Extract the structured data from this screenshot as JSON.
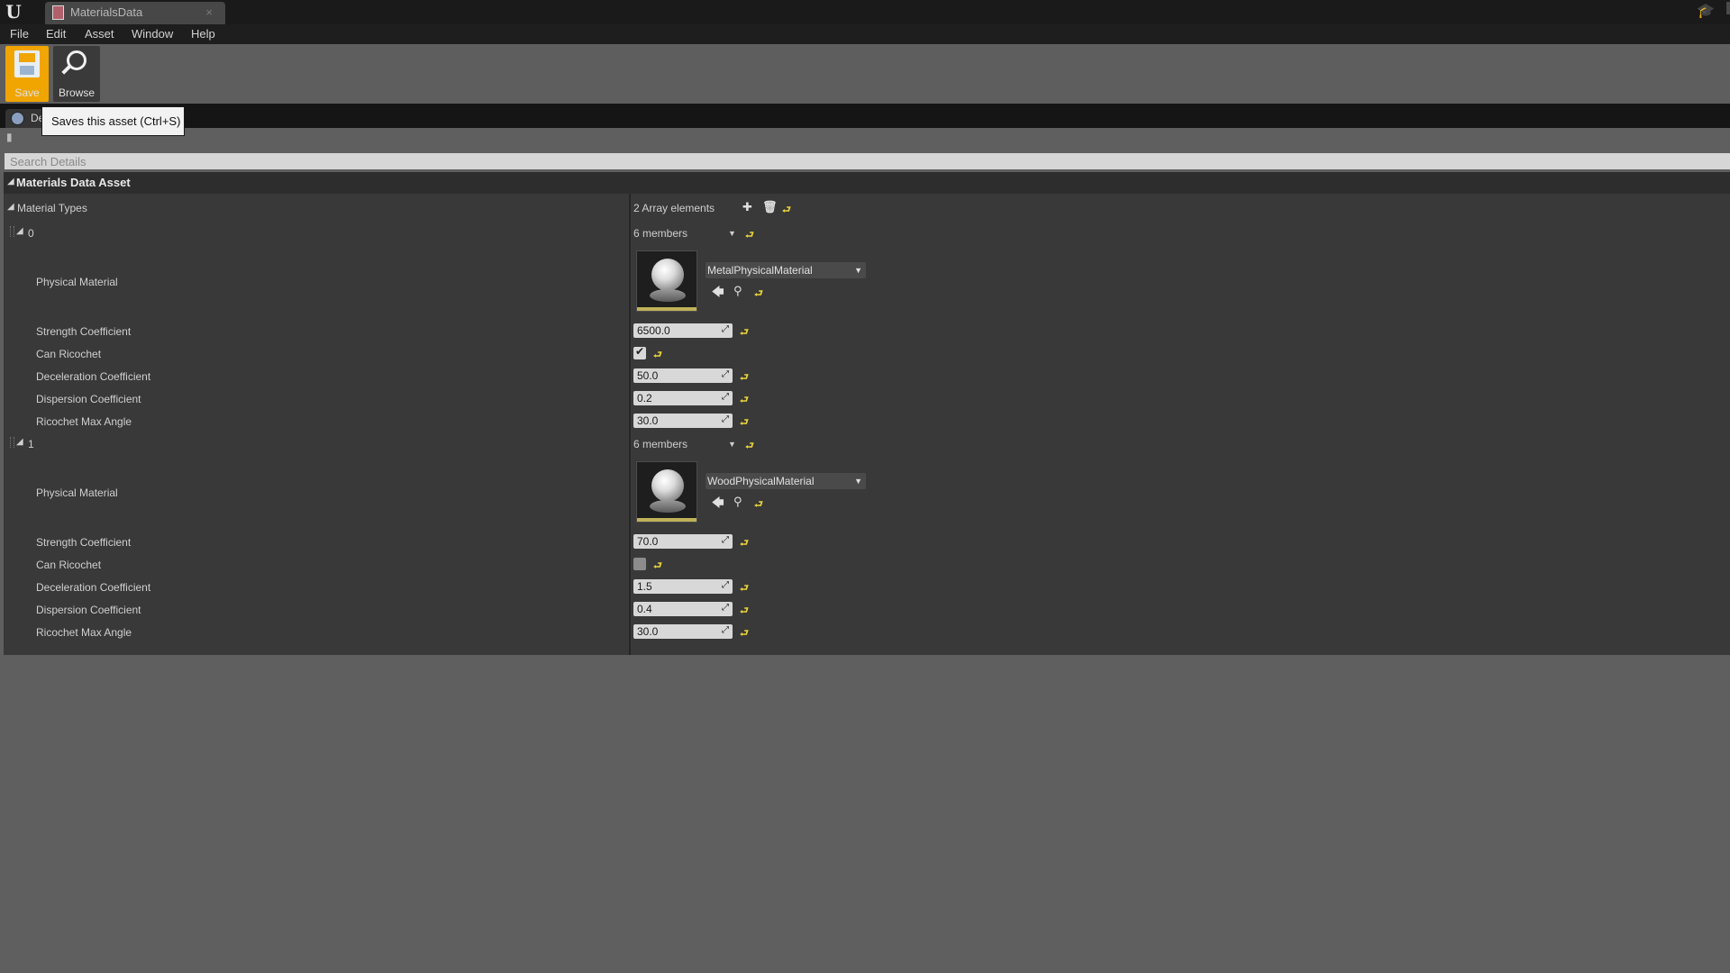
{
  "window": {
    "logo": "U",
    "tab_title": "MaterialsData",
    "tab_close": "×",
    "help_glyph": "🎓"
  },
  "menu": {
    "items": [
      "File",
      "Edit",
      "Asset",
      "Window",
      "Help"
    ]
  },
  "toolbar": {
    "save_label": "Save",
    "browse_label": "Browse"
  },
  "details_tab": {
    "label": "De"
  },
  "tooltip": {
    "text": "Saves this asset (Ctrl+S)"
  },
  "search": {
    "placeholder": "Search Details"
  },
  "panel": {
    "category_title": "Materials Data Asset",
    "array": {
      "label": "Material Types",
      "count_text": "2 Array elements",
      "elements": [
        {
          "index": "0",
          "members_text": "6 members",
          "physical_material": {
            "label": "Physical Material",
            "value": "MetalPhysicalMaterial"
          },
          "strength": {
            "label": "Strength Coefficient",
            "value": "6500.0"
          },
          "can_ricochet": {
            "label": "Can Ricochet",
            "checked": true
          },
          "deceleration": {
            "label": "Deceleration Coefficient",
            "value": "50.0"
          },
          "dispersion": {
            "label": "Dispersion Coefficient",
            "value": "0.2"
          },
          "ricochet_max_angle": {
            "label": "Ricochet Max Angle",
            "value": "30.0"
          }
        },
        {
          "index": "1",
          "members_text": "6 members",
          "physical_material": {
            "label": "Physical Material",
            "value": "WoodPhysicalMaterial"
          },
          "strength": {
            "label": "Strength Coefficient",
            "value": "70.0"
          },
          "can_ricochet": {
            "label": "Can Ricochet",
            "checked": false
          },
          "deceleration": {
            "label": "Deceleration Coefficient",
            "value": "1.5"
          },
          "dispersion": {
            "label": "Dispersion Coefficient",
            "value": "0.4"
          },
          "ricochet_max_angle": {
            "label": "Ricochet Max Angle",
            "value": "30.0"
          }
        }
      ]
    }
  },
  "icons": {
    "reset": "reset-to-default-icon",
    "add": "add-element-icon",
    "delete": "delete-all-icon",
    "use_selected": "use-selected-asset-icon",
    "browse_asset": "browse-to-asset-icon"
  },
  "colors": {
    "save_highlight": "#f0a500",
    "reset_arrow": "#e8d23a",
    "thumbnail_stripe": "#bfb259"
  }
}
